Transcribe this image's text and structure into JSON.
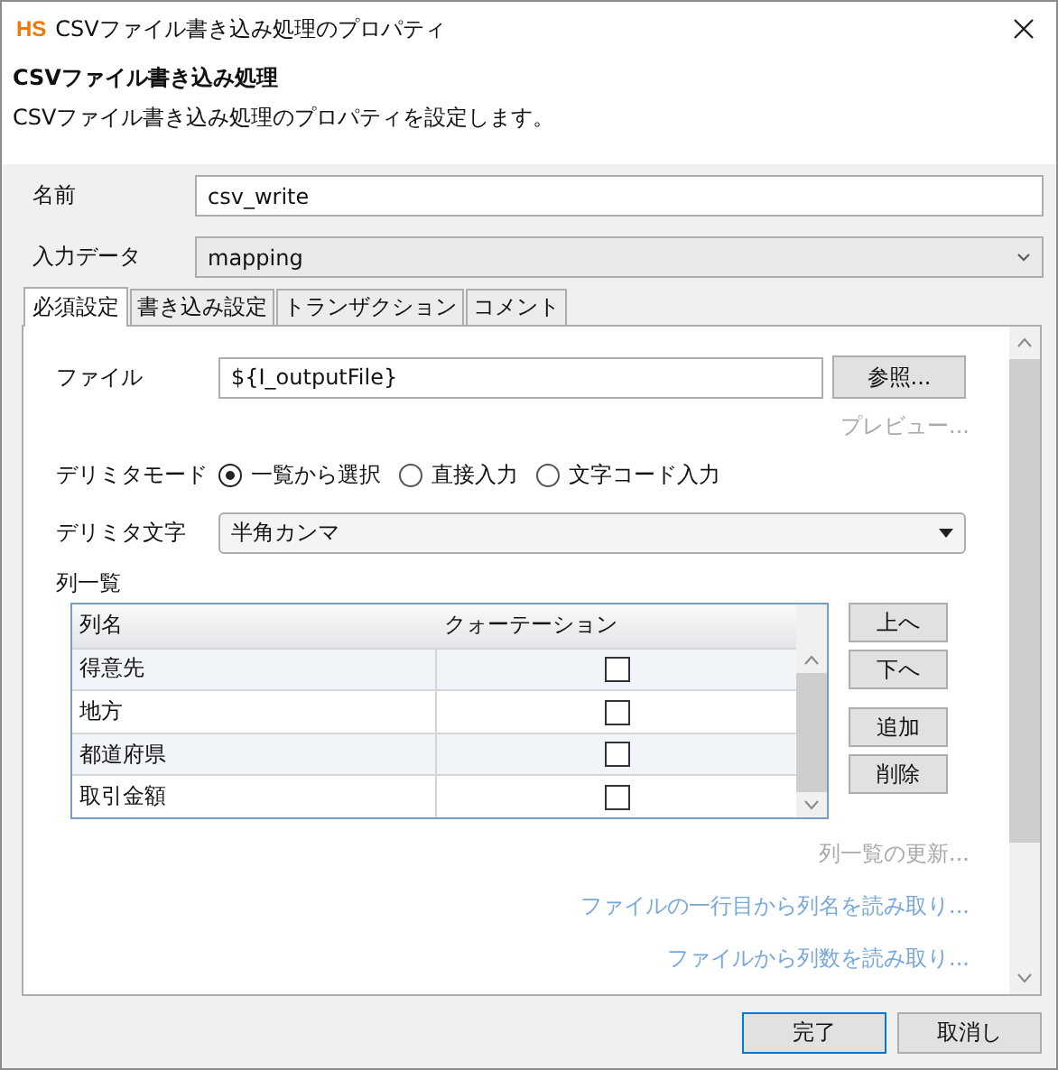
{
  "window": {
    "logo": "HS",
    "title": "CSVファイル書き込み処理のプロパティ"
  },
  "header": {
    "title": "CSVファイル書き込み処理",
    "description": "CSVファイル書き込み処理のプロパティを設定します。"
  },
  "fields": [
    {
      "label": "名前",
      "kind": "text",
      "value": "csv_write"
    },
    {
      "label": "入力データ",
      "kind": "select",
      "value": "mapping"
    }
  ],
  "tabs": [
    {
      "label": "必須設定",
      "selected": true
    },
    {
      "label": "書き込み設定",
      "selected": false
    },
    {
      "label": "トランザクション",
      "selected": false
    },
    {
      "label": "コメント",
      "selected": false
    }
  ],
  "file": {
    "label": "ファイル",
    "value": "${I_outputFile}",
    "button": "参照..."
  },
  "preview_link": {
    "label": "プレビュー...",
    "disabled": true
  },
  "delimiter_mode": {
    "label": "デリミタモード",
    "options": [
      {
        "label": "一覧から選択",
        "selected": true
      },
      {
        "label": "直接入力",
        "selected": false
      },
      {
        "label": "文字コード入力",
        "selected": false
      }
    ]
  },
  "delimiter_char": {
    "label": "デリミタ文字",
    "value": "半角カンマ"
  },
  "column_list": {
    "label": "列一覧",
    "columns": [
      "列名",
      "クォーテーション"
    ],
    "rows": [
      {
        "name": "得意先",
        "quoted": false
      },
      {
        "name": "地方",
        "quoted": false
      },
      {
        "name": "都道府県",
        "quoted": false
      },
      {
        "name": "取引金額",
        "quoted": false
      }
    ],
    "buttons": [
      "上へ",
      "下へ",
      "追加",
      "削除"
    ]
  },
  "links": [
    {
      "label": "列一覧の更新...",
      "disabled": true
    },
    {
      "label": "ファイルの一行目から列名を読み取り...",
      "disabled": false
    },
    {
      "label": "ファイルから列数を読み取り...",
      "disabled": false
    }
  ],
  "footer_buttons": [
    {
      "label": "完了",
      "default": true
    },
    {
      "label": "取消し",
      "default": false
    }
  ]
}
